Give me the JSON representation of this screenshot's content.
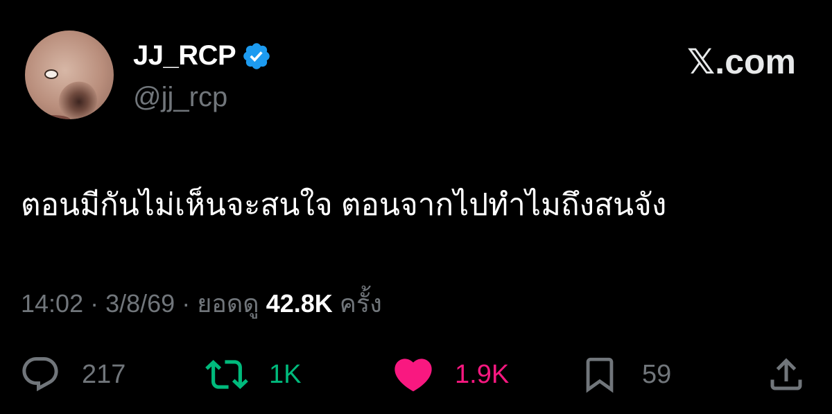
{
  "author": {
    "display_name": "JJ_RCP",
    "handle": "@jj_rcp",
    "verified_icon": "verified-badge-icon",
    "avatar_icon": "avatar"
  },
  "brand": "𝕏.com",
  "tweet": {
    "text": "ตอนมีกันไม่เห็นจะสนใจ ตอนจากไปทำไมถึงสนจัง"
  },
  "meta": {
    "time": "14:02",
    "sep1": " · ",
    "date": "3/8/69",
    "sep2": " · ",
    "views_label": "ยอดดู",
    "views_count": "42.8K",
    "views_suffix": "ครั้ง"
  },
  "actions": {
    "reply_count": "217",
    "retweet_count": "1K",
    "like_count": "1.9K",
    "bookmark_count": "59"
  },
  "colors": {
    "background": "#000000",
    "muted": "#71767b",
    "verified": "#1d9bf0",
    "retweet": "#00ba7c",
    "like": "#f91880"
  }
}
